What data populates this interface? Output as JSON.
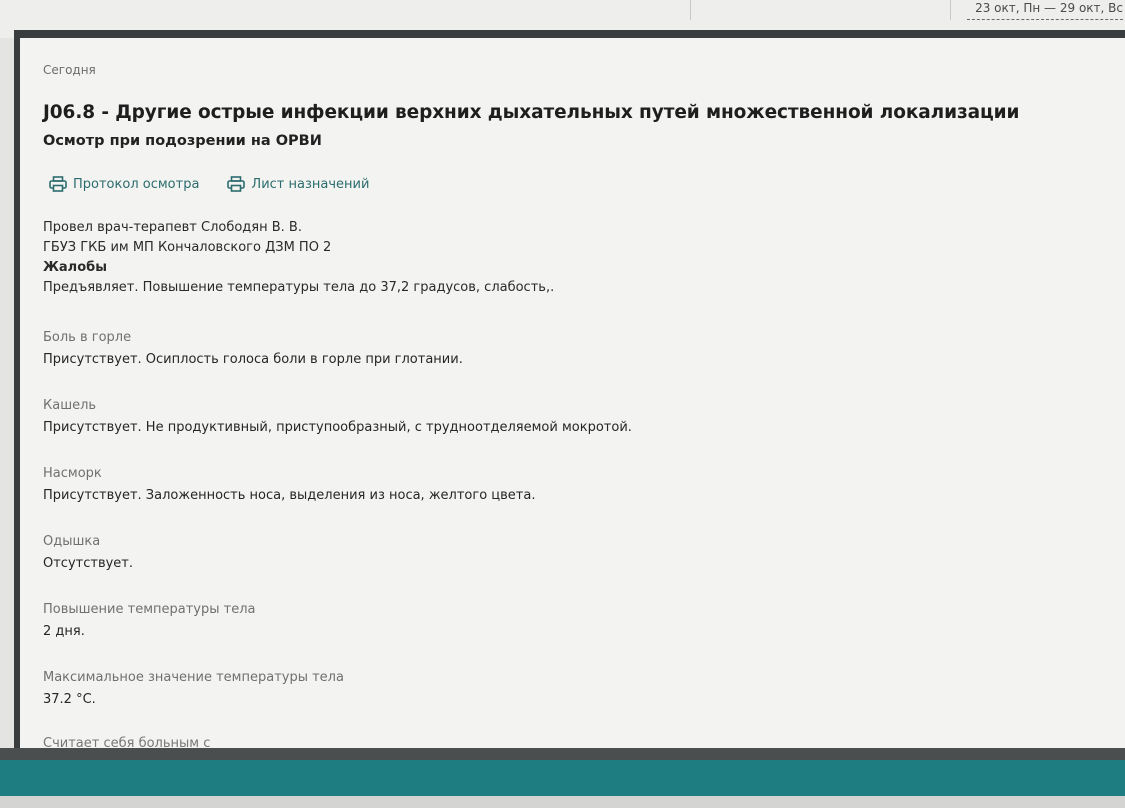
{
  "header": {
    "week_range": "23 окт, Пн — 29 окт, Вс"
  },
  "record": {
    "date_label": "Сегодня",
    "diagnosis": "J06.8 - Другие острые инфекции верхних дыхательных путей множественной локализации",
    "exam_title": "Осмотр при подозрении на ОРВИ",
    "actions": [
      {
        "label": "Протокол осмотра",
        "icon": "printer-icon"
      },
      {
        "label": "Лист назначений",
        "icon": "printer-icon"
      }
    ],
    "doctor": "Провел врач-терапевт Слободян В. В.",
    "clinic": "ГБУЗ ГКБ им МП Кончаловского ДЗМ ПО 2",
    "complaints_title": "Жалобы",
    "complaints_text": "Предъявляет. Повышение температуры тела до 37,2 градусов, слабость,.",
    "sections": [
      {
        "label": "Боль в горле",
        "value": "Присутствует. Осиплость голоса боли в  горле при глотании."
      },
      {
        "label": "Кашель",
        "value": "Присутствует. Не продуктивный,  приступообразный, с трудноотделяемой мокротой."
      },
      {
        "label": "Насморк",
        "value": "Присутствует. Заложенность носа, выделения из носа, желтого цвета."
      },
      {
        "label": "Одышка",
        "value": "Отсутствует."
      },
      {
        "label": "Повышение температуры тела",
        "value": "2 дня."
      },
      {
        "label": "Максимальное значение температуры тела",
        "value": "37.2 °C."
      }
    ],
    "cut_label": "Считает себя больным с"
  },
  "colors": {
    "accent_teal": "#1e7d80",
    "link": "#2c6c6e"
  }
}
